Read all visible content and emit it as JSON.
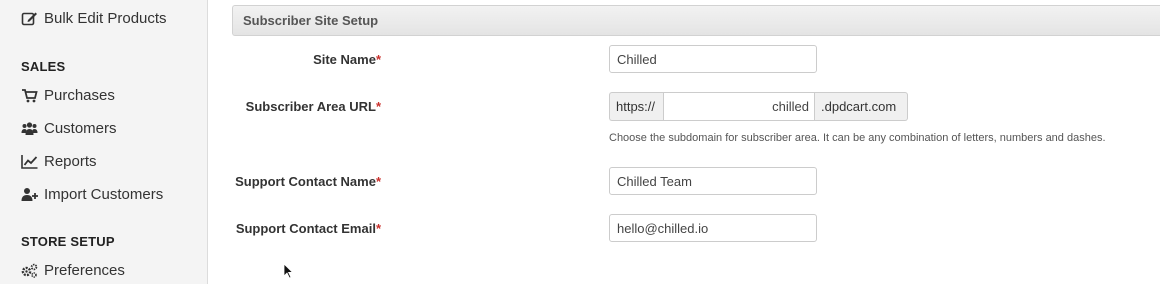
{
  "sidebar": {
    "top_item": {
      "label": "Bulk Edit Products",
      "icon": "edit-icon"
    },
    "sections": [
      {
        "heading": "SALES",
        "items": [
          {
            "label": "Purchases",
            "icon": "cart-icon"
          },
          {
            "label": "Customers",
            "icon": "users-icon"
          },
          {
            "label": "Reports",
            "icon": "line-chart-icon"
          },
          {
            "label": "Import Customers",
            "icon": "user-plus-icon"
          }
        ]
      },
      {
        "heading": "STORE SETUP",
        "items": [
          {
            "label": "Preferences",
            "icon": "gears-icon"
          }
        ]
      }
    ]
  },
  "panel": {
    "title": "Subscriber Site Setup"
  },
  "form": {
    "site_name": {
      "label": "Site Name",
      "required_mark": "*",
      "value": "Chilled"
    },
    "subscriber_url": {
      "label": "Subscriber Area URL",
      "required_mark": "*",
      "prefix": "https://",
      "value": "chilled",
      "suffix": ".dpdcart.com",
      "help": "Choose the subdomain for subscriber area. It can be any combination of letters, numbers and dashes."
    },
    "support_name": {
      "label": "Support Contact Name",
      "required_mark": "*",
      "value": "Chilled Team"
    },
    "support_email": {
      "label": "Support Contact Email",
      "required_mark": "*",
      "value": "hello@chilled.io"
    }
  },
  "colors": {
    "sidebar_bg": "#f4f4f4",
    "required": "#c9302c",
    "panel_header": "#e8e8e8"
  }
}
